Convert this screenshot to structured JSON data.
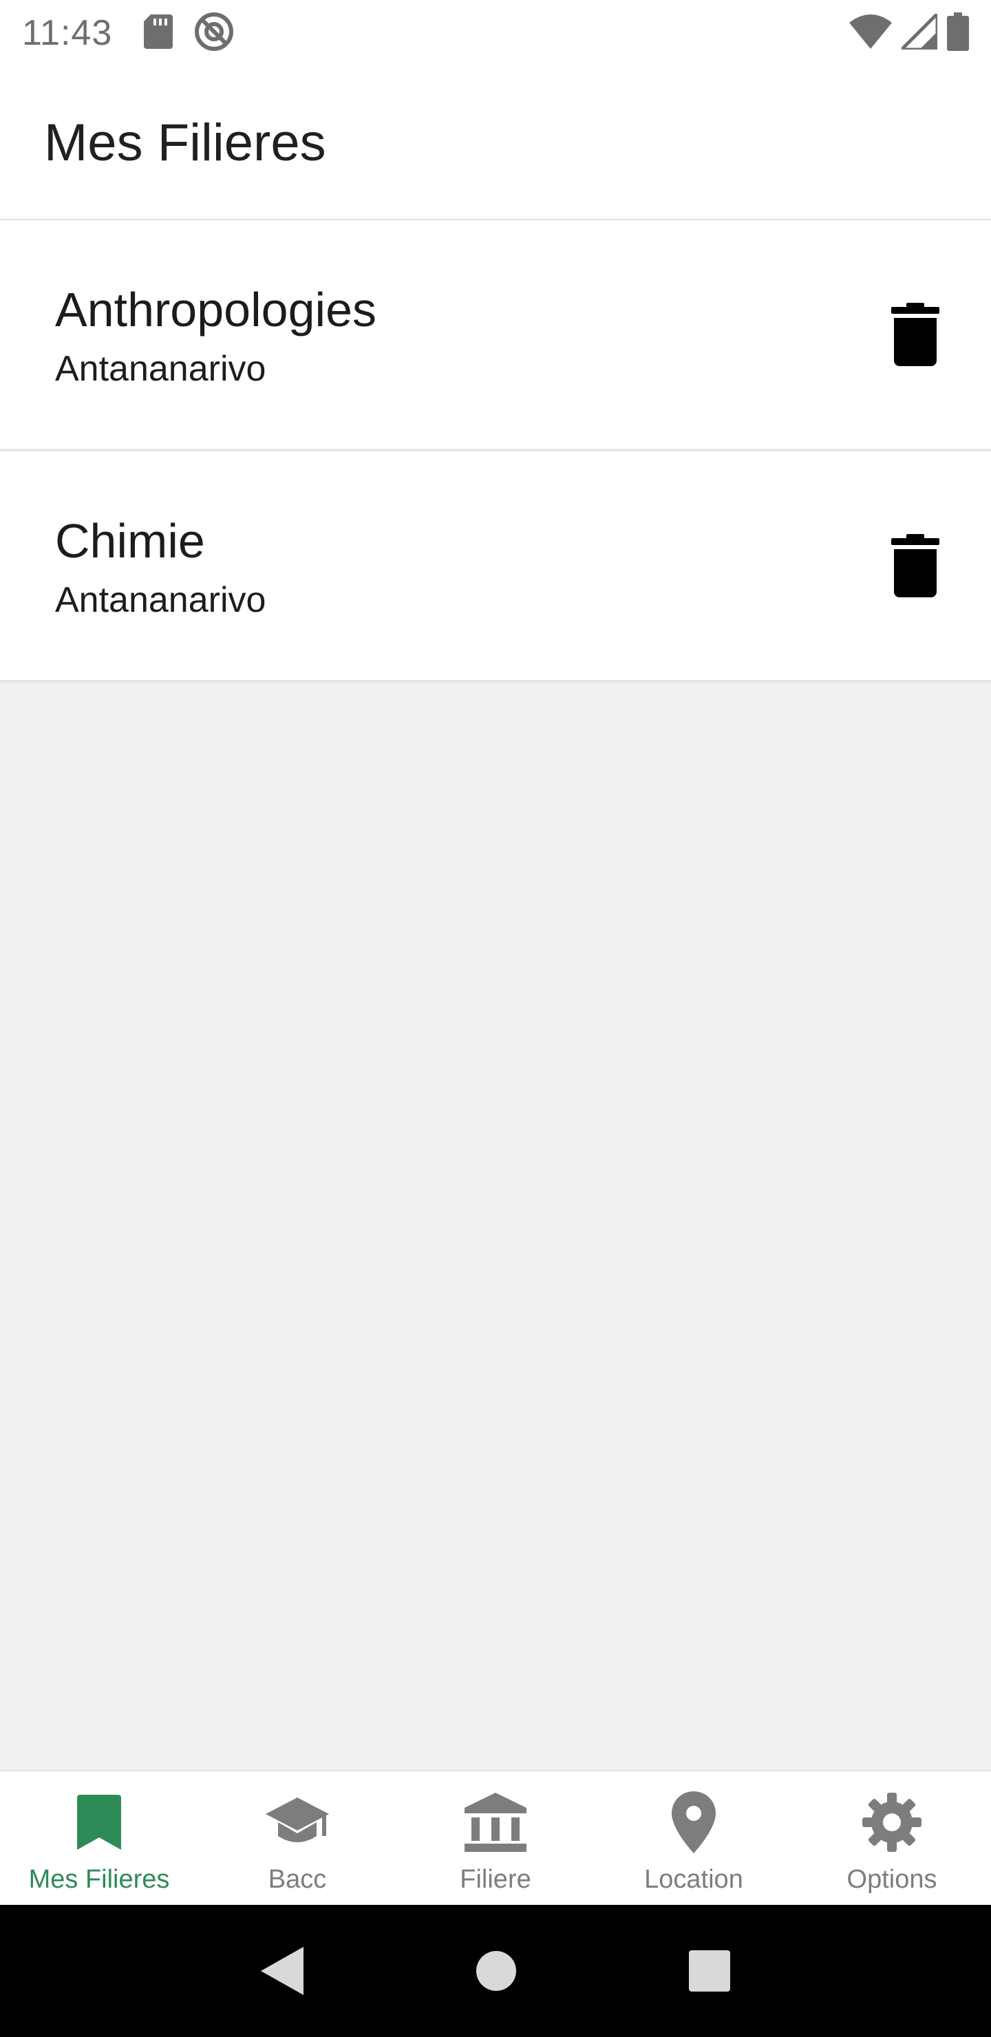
{
  "status_bar": {
    "time": "11:43",
    "icons_left": [
      "sd-card-icon",
      "do-not-disturb-icon"
    ],
    "icons_right": [
      "wifi-icon",
      "cell-signal-icon",
      "battery-icon"
    ]
  },
  "app_bar": {
    "title": "Mes Filieres"
  },
  "list": {
    "items": [
      {
        "title": "Anthropologies",
        "subtitle": "Antananarivo",
        "action_icon": "delete-icon"
      },
      {
        "title": "Chimie",
        "subtitle": "Antananarivo",
        "action_icon": "delete-icon"
      }
    ]
  },
  "bottom_nav": {
    "active_index": 0,
    "active_color": "#2e8b57",
    "inactive_color": "#7d7d7d",
    "items": [
      {
        "label": "Mes Filieres",
        "icon": "bookmark-icon"
      },
      {
        "label": "Bacc",
        "icon": "graduation-cap-icon"
      },
      {
        "label": "Filiere",
        "icon": "institution-icon"
      },
      {
        "label": "Location",
        "icon": "location-pin-icon"
      },
      {
        "label": "Options",
        "icon": "gear-icon"
      }
    ]
  },
  "system_nav": {
    "buttons": [
      "back-icon",
      "home-icon",
      "recents-icon"
    ]
  }
}
